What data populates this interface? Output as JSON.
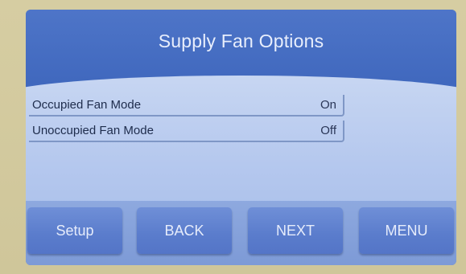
{
  "header": {
    "title": "Supply Fan Options"
  },
  "settings": [
    {
      "label": "Occupied Fan Mode",
      "value": "On"
    },
    {
      "label": "Unoccupied Fan Mode",
      "value": "Off"
    }
  ],
  "buttons": {
    "setup": "Setup",
    "back": "BACK",
    "next": "NEXT",
    "menu": "MENU"
  },
  "colors": {
    "header": "#4e75c8",
    "content": "#c7d6f2",
    "button": "#5a7ccc",
    "bezel": "#d6cda2"
  }
}
